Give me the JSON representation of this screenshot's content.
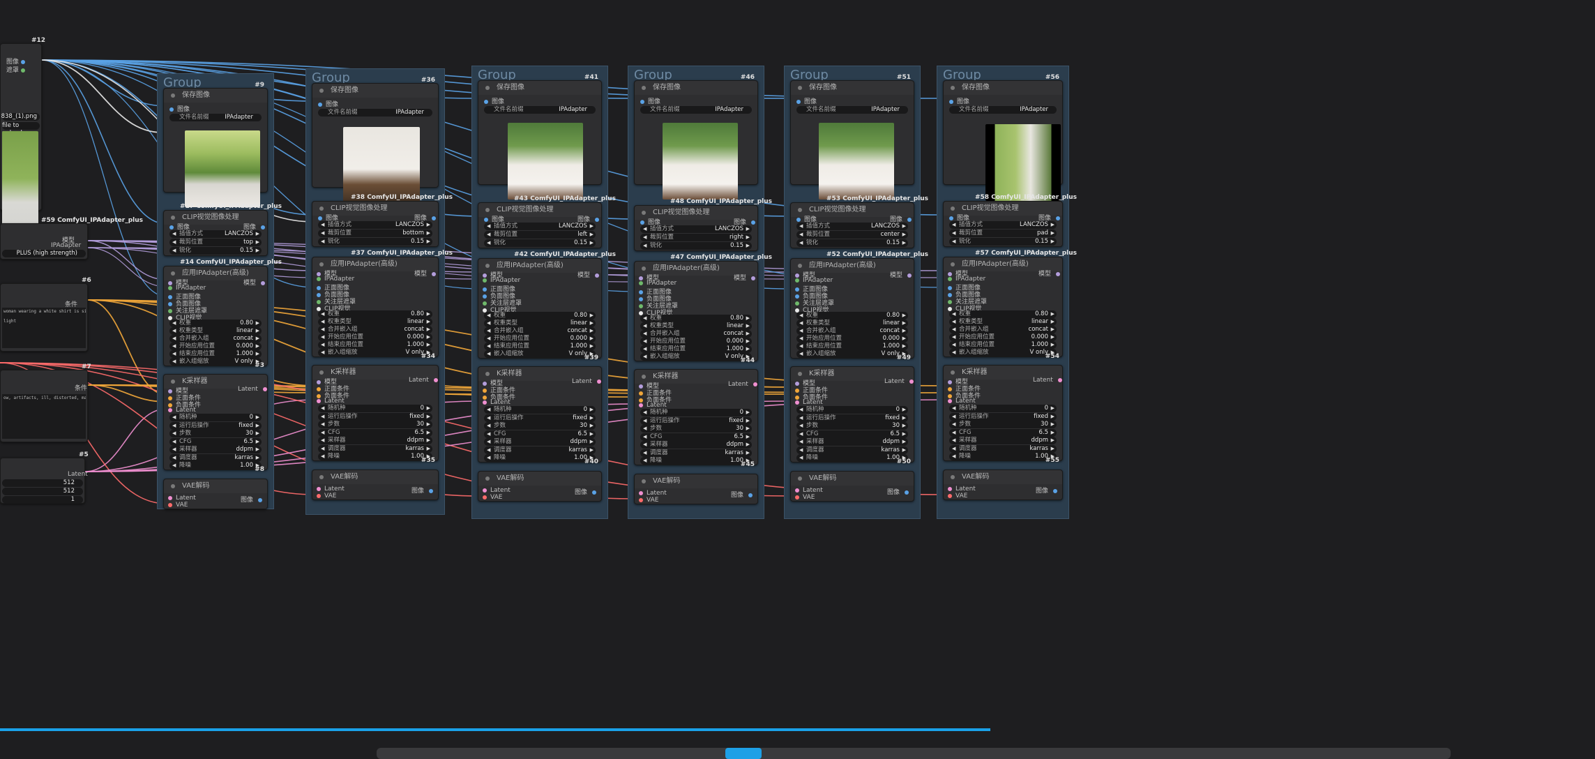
{
  "app": {
    "name": "ComfyUI"
  },
  "groups": [
    {
      "title": "Group",
      "id": "#9"
    },
    {
      "title": "Group",
      "id": "#36"
    },
    {
      "title": "Group",
      "id": "#41"
    },
    {
      "title": "Group",
      "id": "#46"
    },
    {
      "title": "Group",
      "id": "#51"
    },
    {
      "title": "Group",
      "id": "#56"
    }
  ],
  "load_image": {
    "id": "#12",
    "out_image": "图像",
    "out_mask": "遮罩",
    "filename": "838_(1).png",
    "upload": "file to upload"
  },
  "save_node": {
    "title": "保存图像",
    "in_image": "图像",
    "prefix_label": "文件名前缀",
    "prefix_value": "IPAdapter"
  },
  "clip_vision": {
    "title": "CLIP视觉图像处理",
    "in_image": "图像",
    "out_image": "图像",
    "w_interp": "插值方式",
    "w_interp_val": "LANCZOS",
    "w_crop": "裁剪位置",
    "w_sharpen": "锐化",
    "w_sharpen_val": "0.15"
  },
  "crop_positions": [
    "top",
    "bottom",
    "left",
    "right",
    "center",
    "pad"
  ],
  "clip_ids": [
    "#17 ComfyUI_IPAdapter_plus",
    "#38 ComfyUI_IPAdapter_plus",
    "#43 ComfyUI_IPAdapter_plus",
    "#48 ComfyUI_IPAdapter_plus",
    "#53 ComfyUI_IPAdapter_plus",
    "#58 ComfyUI_IPAdapter_plus"
  ],
  "ipa_ids": [
    "#14 ComfyUI_IPAdapter_plus",
    "#37 ComfyUI_IPAdapter_plus",
    "#42 ComfyUI_IPAdapter_plus",
    "#47 ComfyUI_IPAdapter_plus",
    "#52 ComfyUI_IPAdapter_plus",
    "#57 ComfyUI_IPAdapter_plus"
  ],
  "ipa": {
    "title": "应用IPAdapter(高级)",
    "in_model": "模型",
    "in_ipadapter": "IPAdapter",
    "in_pos_image": "正面图像",
    "in_neg_image": "负面图像",
    "in_mask": "关注层遮罩",
    "in_clip": "CLIP视觉",
    "out_model": "模型",
    "widgets": [
      {
        "label": "权重",
        "value": "0.80"
      },
      {
        "label": "权重类型",
        "value": "linear"
      },
      {
        "label": "合并嵌入组",
        "value": "concat"
      },
      {
        "label": "开始应用位置",
        "value": "0.000"
      },
      {
        "label": "结束应用位置",
        "value": "1.000"
      },
      {
        "label": "嵌入组缩放",
        "value": "V only"
      }
    ]
  },
  "ipa_bottom_ids": [
    "#3",
    "#34",
    "#39",
    "#44",
    "#49",
    "#54"
  ],
  "ksampler": {
    "title": "K采样器",
    "in_model": "模型",
    "in_pos": "正面条件",
    "in_neg": "负面条件",
    "in_latent": "Latent",
    "out_latent": "Latent",
    "widgets": [
      {
        "label": "随机种",
        "value": "0"
      },
      {
        "label": "运行后操作",
        "value": "fixed"
      },
      {
        "label": "步数",
        "value": "30"
      },
      {
        "label": "CFG",
        "value": "6.5"
      },
      {
        "label": "采样器",
        "value": "ddpm"
      },
      {
        "label": "调度器",
        "value": "karras"
      },
      {
        "label": "降噪",
        "value": "1.00"
      }
    ]
  },
  "ks_bottom_ids": [
    "#8",
    "#35",
    "#40",
    "#45",
    "#50",
    "#55"
  ],
  "vae": {
    "title": "VAE解码",
    "in_latent": "Latent",
    "in_vae": "VAE",
    "out_image": "图像"
  },
  "left_nodes": {
    "ipa_loader_id": "#59 ComfyUI_IPAdapter_plus",
    "ipa_loader_out_model": "模型",
    "ipa_loader_out_ipa": "IPAdapter",
    "ipa_loader_preset": "PLUS (high strength)",
    "pos_id": "#6",
    "pos_out": "条件",
    "pos_text": "woman wearing a white shirt is sitting in a\n\nlight",
    "neg_id": "#7",
    "neg_out": "条件",
    "neg_text": "ow, artifacts, ill, distorted, malformed",
    "latent_id": "#5",
    "latent_out": "Latent",
    "latent_w": "512",
    "latent_h": "512",
    "latent_b": "1"
  },
  "colors": {
    "background": "#1e1e20",
    "group_fill": "#2b3d4d",
    "node_fill": "#2e2e30",
    "wire_image": "#5aa2e6",
    "wire_model": "#b39ddb",
    "wire_cond": "#f0a63a",
    "wire_latent": "#ef8fd0",
    "wire_vae": "#ff6b6b",
    "wire_clipvision": "#e8e8e8",
    "scroll": "#1ea0e6"
  }
}
